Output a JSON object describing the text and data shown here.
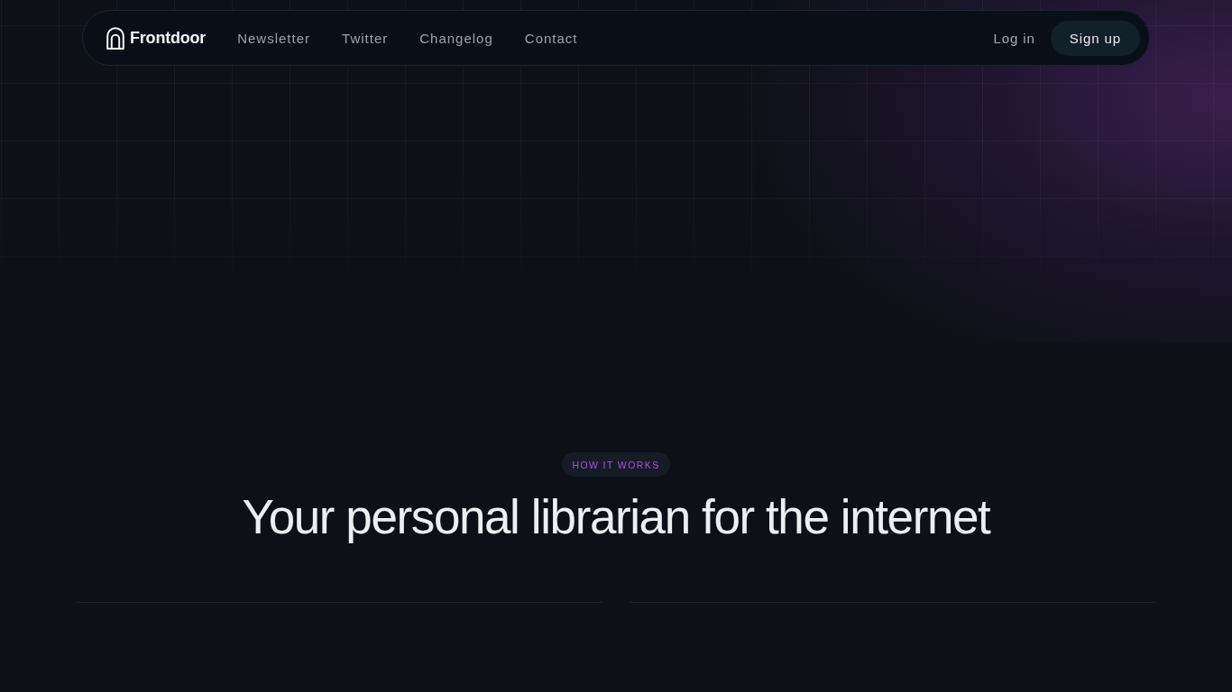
{
  "nav": {
    "brand": "Frontdoor",
    "links": [
      "Newsletter",
      "Twitter",
      "Changelog",
      "Contact"
    ],
    "login": "Log in",
    "signup": "Sign up"
  },
  "section": {
    "badge": "HOW IT WORKS",
    "heading": "Your personal librarian for the internet"
  }
}
